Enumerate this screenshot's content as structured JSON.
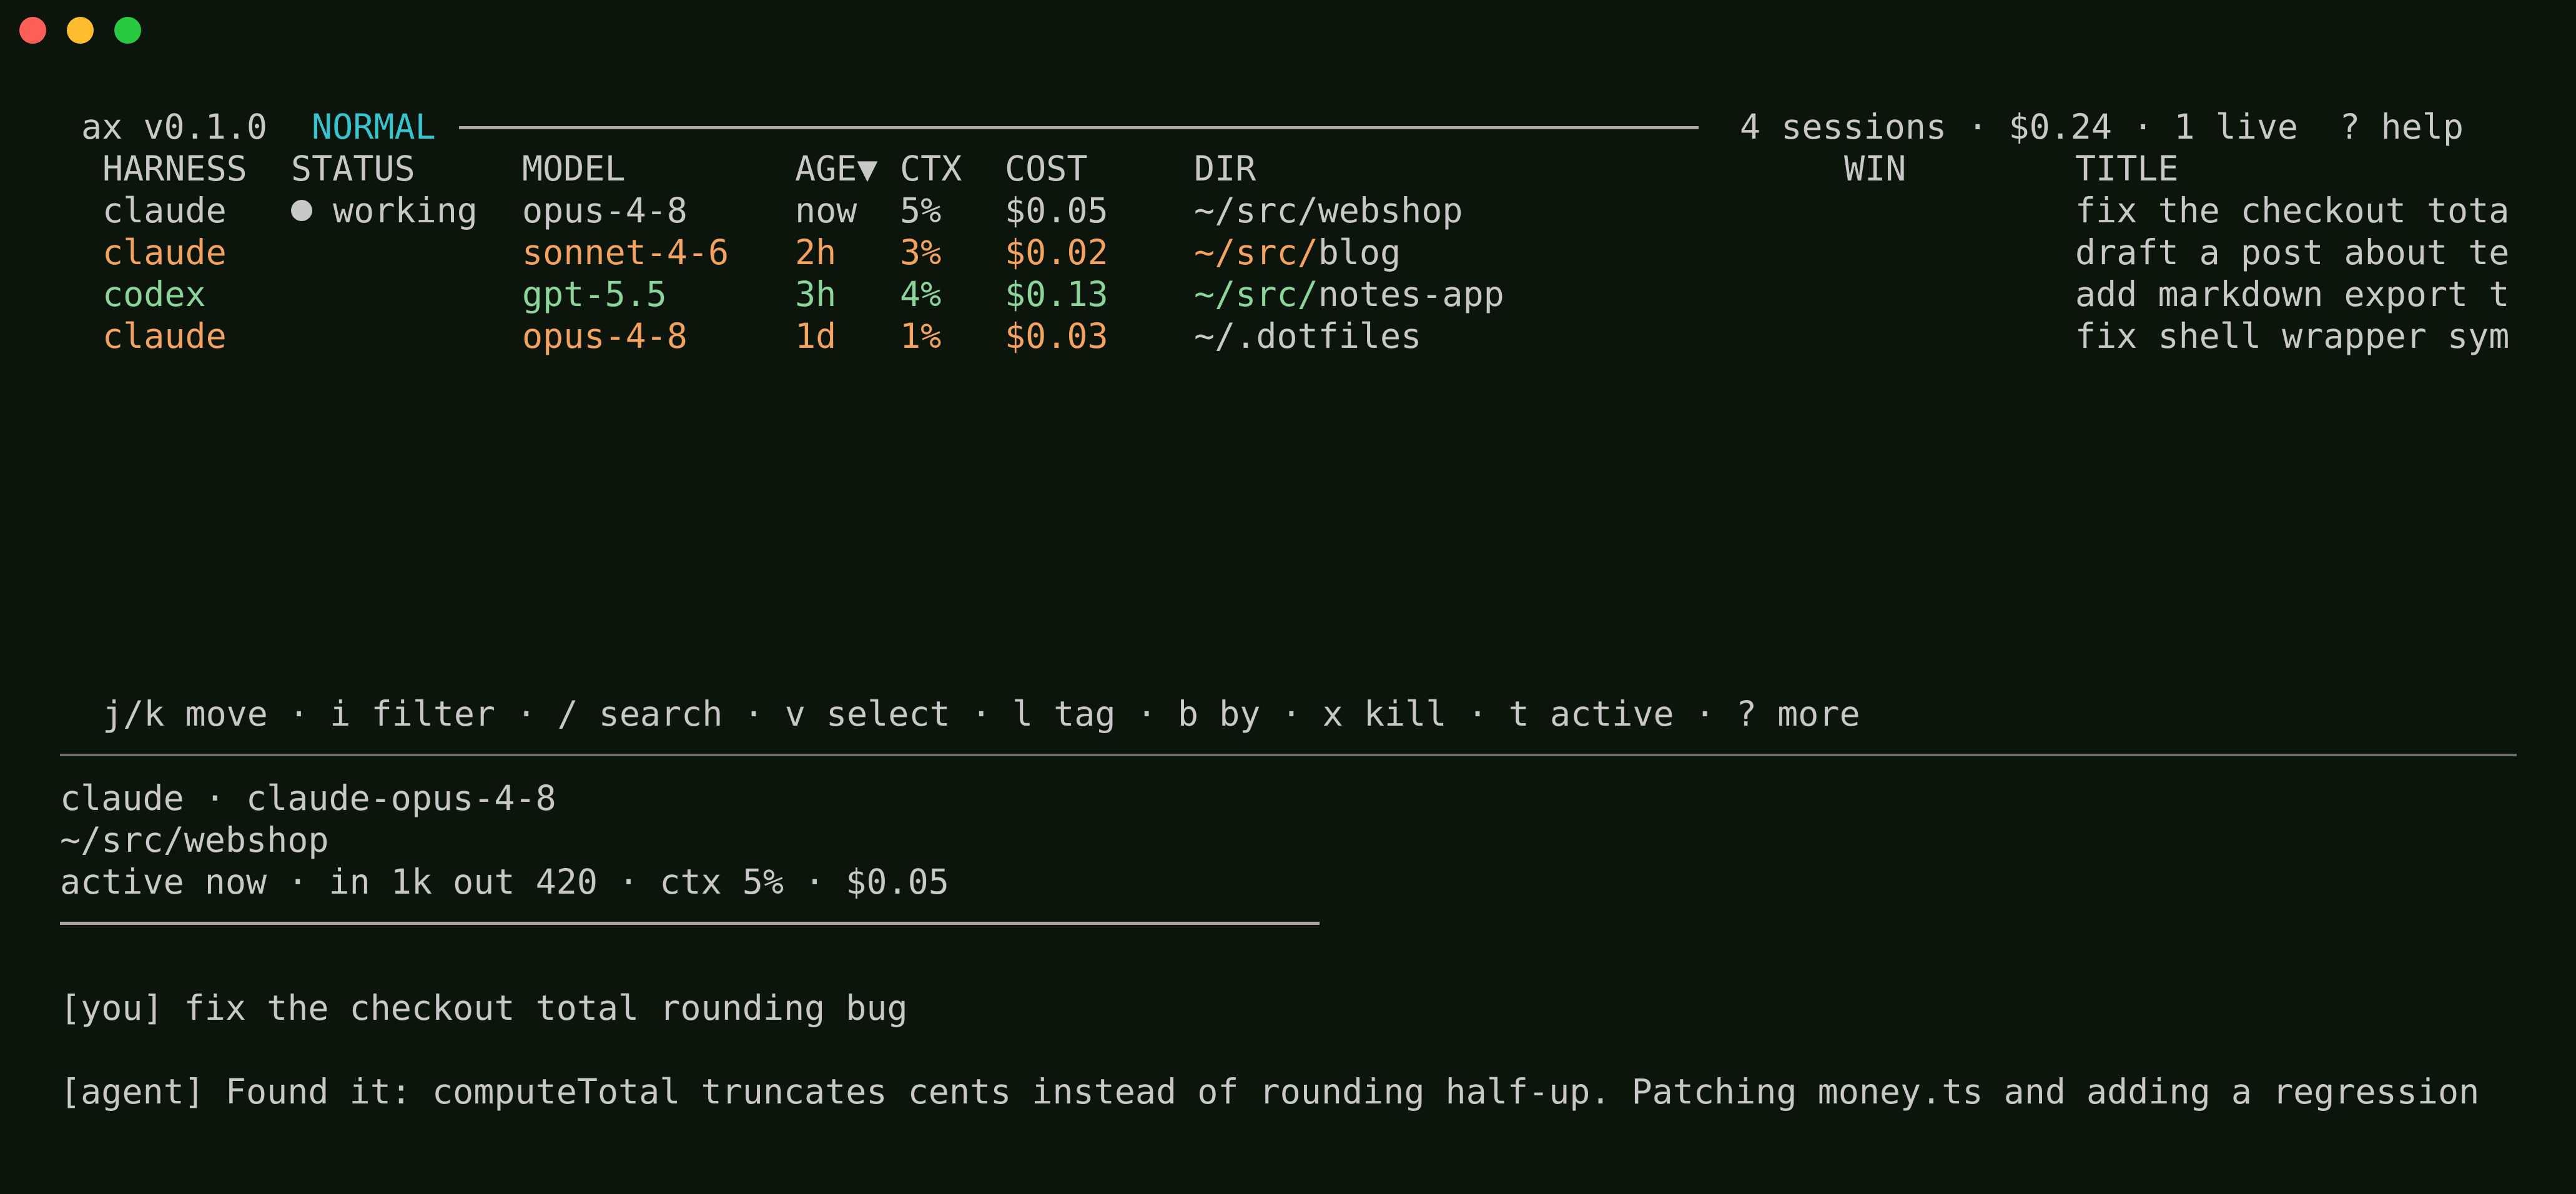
{
  "window": {
    "buttons": [
      "close",
      "minimize",
      "zoom"
    ]
  },
  "header": {
    "app": "ax v0.1.0",
    "mode": "NORMAL",
    "summary": "4 sessions · $0.24 · 1 live  ? help"
  },
  "table": {
    "columns": {
      "harness": "HARNESS",
      "status": "STATUS",
      "model": "MODEL",
      "age": "AGE▼",
      "ctx": "CTX",
      "cost": "COST",
      "dir": "DIR",
      "win": "WIN",
      "title": "TITLE"
    },
    "rows": [
      {
        "harness": "claude",
        "status": "working",
        "model": "opus-4-8",
        "age": "now",
        "ctx": "5%",
        "cost": "$0.05",
        "dir_prefix": "~/src/webshop",
        "dir_name": "",
        "win": "",
        "title": "fix the checkout tota"
      },
      {
        "harness": "claude",
        "status": "",
        "model": "sonnet-4-6",
        "age": "2h",
        "ctx": "3%",
        "cost": "$0.02",
        "dir_prefix": "~/src/",
        "dir_name": "blog",
        "win": "",
        "title": "draft a post about te"
      },
      {
        "harness": "codex",
        "status": "",
        "model": "gpt-5.5",
        "age": "3h",
        "ctx": "4%",
        "cost": "$0.13",
        "dir_prefix": "~/src/",
        "dir_name": "notes-app",
        "win": "",
        "title": "add markdown export t"
      },
      {
        "harness": "claude",
        "status": "",
        "model": "opus-4-8",
        "age": "1d",
        "ctx": "1%",
        "cost": "$0.03",
        "dir_prefix": "~/.dotfiles",
        "dir_name": "",
        "win": "",
        "title": "fix shell wrapper sym"
      }
    ]
  },
  "keybar": "j/k move · i filter · / search · v select · l tag · b by · x kill · t active · ? more",
  "detail": {
    "line1": "claude · claude-opus-4-8",
    "line2": "~/src/webshop",
    "line3": "active now · in 1k out 420 · ctx 5% · $0.05"
  },
  "transcript": {
    "you": "[you] fix the checkout total rounding bug",
    "agent": "[agent] Found it: computeTotal truncates cents instead of rounding half-up. Patching money.ts and adding a regression"
  },
  "colors": {
    "background": "#0c150b",
    "text": "#c8c8c8",
    "mode": "#37c4cf",
    "row_orange": "#f4a261",
    "row_green": "#8bd49b"
  }
}
